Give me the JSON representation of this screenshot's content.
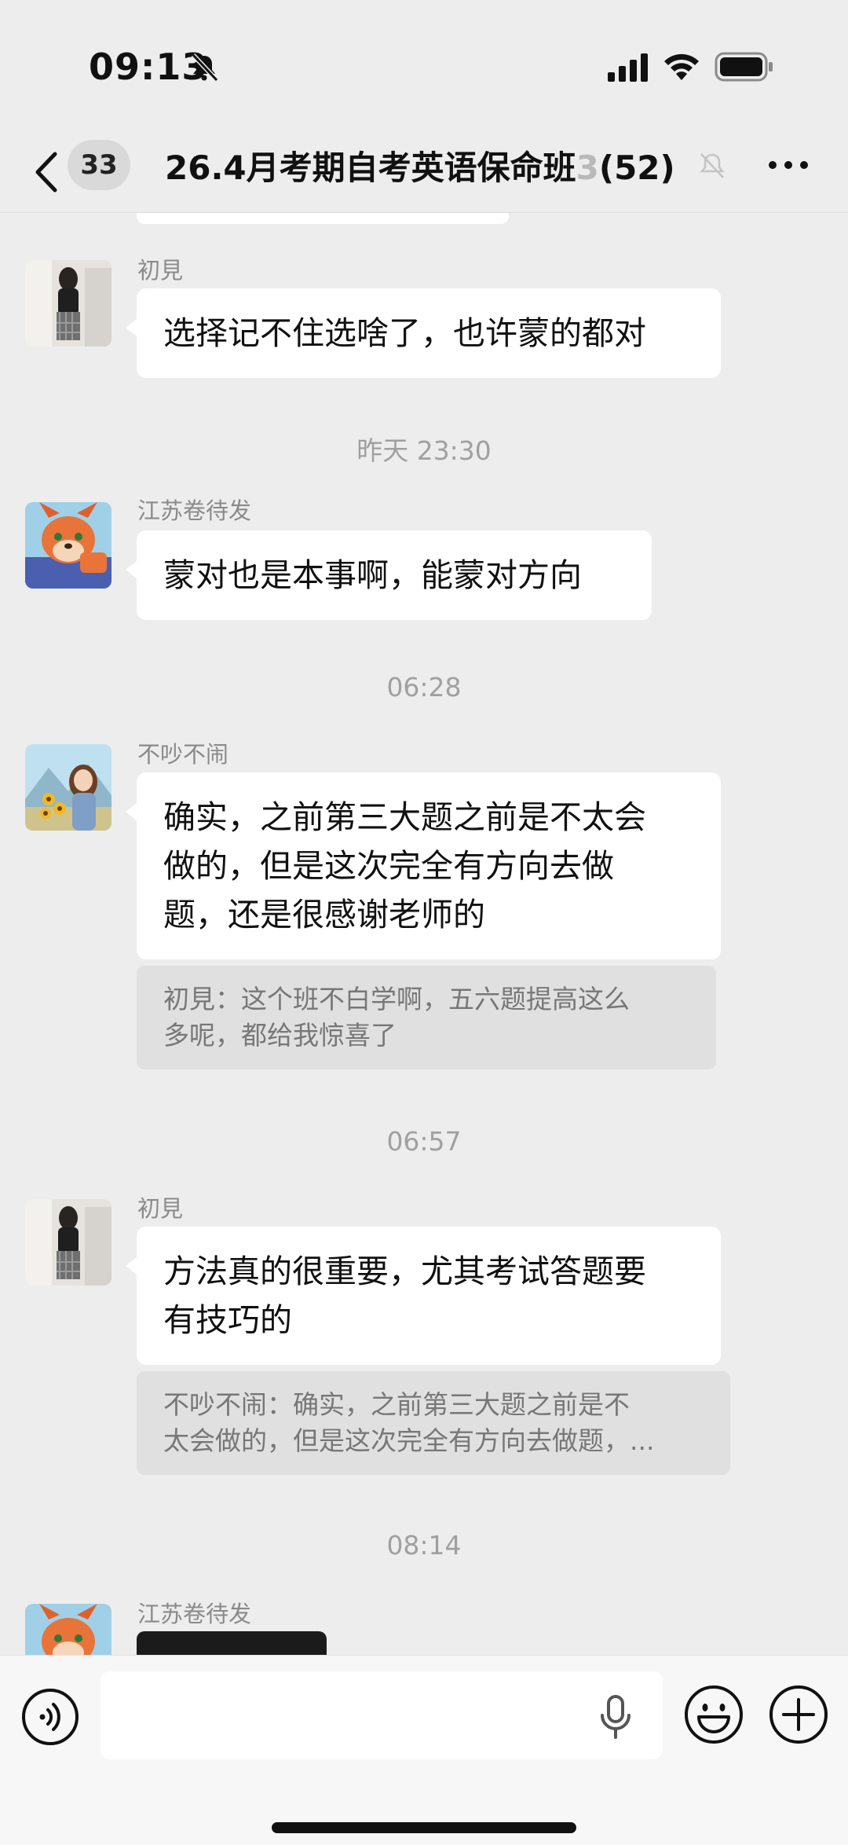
{
  "status_bar": {
    "time": "09:13"
  },
  "nav": {
    "unread_count": "33",
    "title_main": "26.4月考期自考英语保命班",
    "title_fade": "3",
    "member_count": "(52)"
  },
  "messages": [
    {
      "type": "text",
      "sender": "初見",
      "text": "选择记不住选啥了，也许蒙的都对"
    },
    {
      "type": "time",
      "text": "昨天 23:30"
    },
    {
      "type": "text",
      "sender": "江苏卷待发",
      "text": "蒙对也是本事啊，能蒙对方向"
    },
    {
      "type": "time",
      "text": "06:28"
    },
    {
      "type": "text",
      "sender": "不吵不闹",
      "lines": [
        "确实，之前第三大题之前是不太会",
        "做的，但是这次完全有方向去做",
        "题，还是很感谢老师的"
      ],
      "quote_lines": [
        "初見：这个班不白学啊，五六题提高这么",
        "多呢，都给我惊喜了"
      ]
    },
    {
      "type": "time",
      "text": "06:57"
    },
    {
      "type": "text",
      "sender": "初見",
      "lines": [
        "方法真的很重要，尤其考试答题要",
        "有技巧的"
      ],
      "quote_lines": [
        "不吵不闹：确实，之前第三大题之前是不",
        "太会做的，但是这次完全有方向去做题，..."
      ]
    },
    {
      "type": "time",
      "text": "08:14"
    },
    {
      "type": "image",
      "sender": "江苏卷待发"
    }
  ],
  "input": {
    "value": "",
    "placeholder": ""
  },
  "colors": {
    "background": "#ededed",
    "bubble": "#ffffff",
    "quote": "#e0e0e0"
  }
}
